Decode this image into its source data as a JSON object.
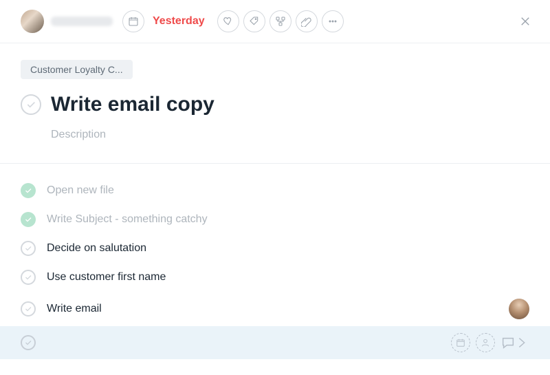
{
  "header": {
    "assignee_name": "",
    "date_label": "Yesterday"
  },
  "task": {
    "tag": "Customer Loyalty C...",
    "title": "Write email copy",
    "description_placeholder": "Description"
  },
  "subtasks": [
    {
      "label": "Open new file",
      "done": true
    },
    {
      "label": "Write Subject - something catchy",
      "done": true
    },
    {
      "label": "Decide on salutation",
      "done": false
    },
    {
      "label": "Use customer first name",
      "done": false
    },
    {
      "label": "Write email",
      "done": false,
      "has_avatar": true
    }
  ],
  "colors": {
    "overdue": "#ef4a4a",
    "done_check_bg": "#b7e4cf",
    "new_row_bg": "#eaf3f9"
  }
}
